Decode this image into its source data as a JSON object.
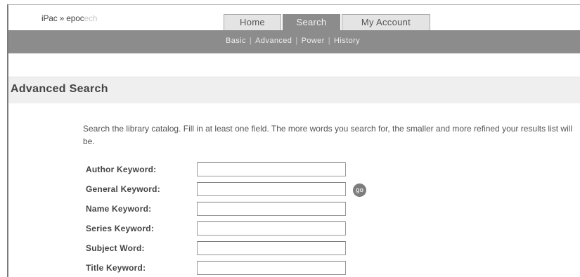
{
  "header": {
    "logo_main": "iPac",
    "logo_sep": " » ",
    "logo_sub": "epoc",
    "logo_faint": "ech"
  },
  "tabs": [
    {
      "label": "Home",
      "active": false
    },
    {
      "label": "Search",
      "active": true
    },
    {
      "label": "My Account",
      "active": false
    }
  ],
  "subnav": [
    {
      "label": "Basic"
    },
    {
      "label": "Advanced"
    },
    {
      "label": "Power"
    },
    {
      "label": "History"
    }
  ],
  "page_title": "Advanced Search",
  "intro_text": "Search the library catalog. Fill in at least one field. The more words you search for, the smaller and more refined your results list will be.",
  "fields": [
    {
      "label": "Author Keyword:",
      "value": ""
    },
    {
      "label": "General Keyword:",
      "value": ""
    },
    {
      "label": "Name Keyword:",
      "value": ""
    },
    {
      "label": "Series Keyword:",
      "value": ""
    },
    {
      "label": "Subject Word:",
      "value": ""
    },
    {
      "label": "Title Keyword:",
      "value": ""
    }
  ],
  "go_button_label": "go"
}
